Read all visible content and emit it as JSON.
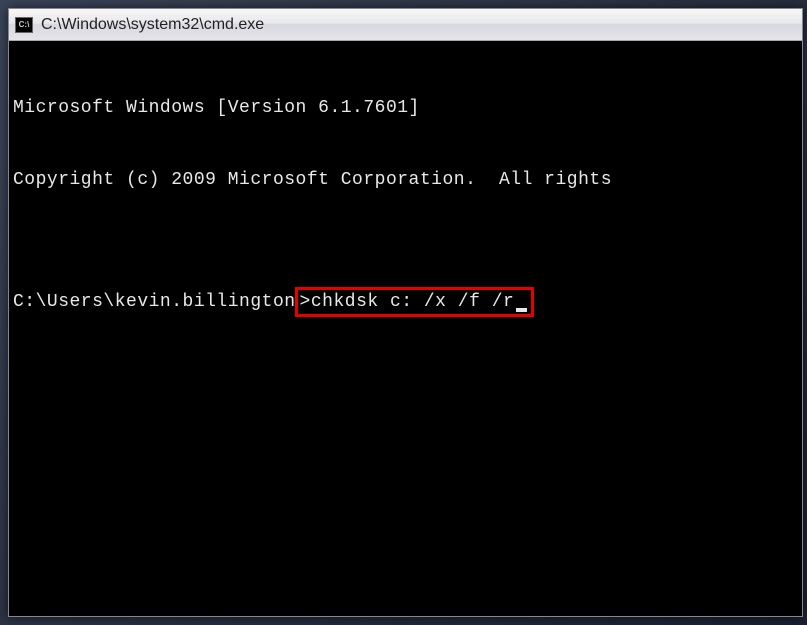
{
  "window": {
    "icon_label": "C:\\",
    "title": "C:\\Windows\\system32\\cmd.exe"
  },
  "terminal": {
    "line1": "Microsoft Windows [Version 6.1.7601]",
    "line2": "Copyright (c) 2009 Microsoft Corporation.  All rights",
    "blank": "",
    "prompt": "C:\\Users\\kevin.billington",
    "command_prefix": ">",
    "command": "chkdsk c: /x /f /r"
  }
}
